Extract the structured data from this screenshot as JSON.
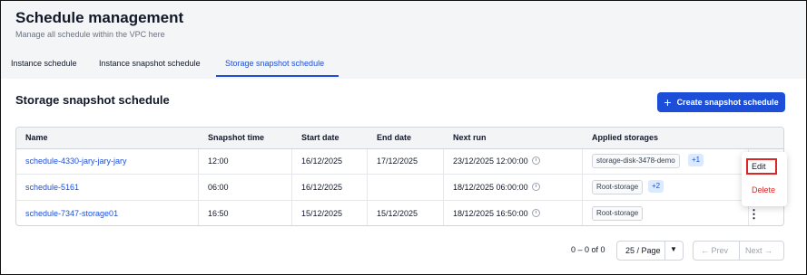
{
  "header": {
    "title": "Schedule management",
    "subtitle": "Manage all schedule within the VPC here"
  },
  "tabs": [
    {
      "label": "Instance schedule",
      "active": false
    },
    {
      "label": "Instance snapshot schedule",
      "active": false
    },
    {
      "label": "Storage snapshot schedule",
      "active": true
    }
  ],
  "section": {
    "title": "Storage snapshot schedule",
    "create_button": "Create snapshot schedule",
    "create_icon": "plus-icon"
  },
  "table": {
    "columns": [
      "Name",
      "Snapshot time",
      "Start date",
      "End date",
      "Next run",
      "Applied storages"
    ],
    "rows": [
      {
        "name": "schedule-4330-jary-jary-jary",
        "time": "12:00",
        "start": "16/12/2025",
        "end": "17/12/2025",
        "next": "23/12/2025 12:00:00",
        "storage": "storage-disk-3478-demo",
        "more": "+1"
      },
      {
        "name": "schedule-5161",
        "time": "06:00",
        "start": "16/12/2025",
        "end": "",
        "next": "18/12/2025 06:00:00",
        "storage": "Root-storage",
        "more": "+2"
      },
      {
        "name": "schedule-7347-storage01",
        "time": "16:50",
        "start": "15/12/2025",
        "end": "15/12/2025",
        "next": "18/12/2025 16:50:00",
        "storage": "Root-storage",
        "more": ""
      }
    ]
  },
  "context_menu": {
    "edit": "Edit",
    "delete": "Delete"
  },
  "pagination": {
    "count": "0 – 0 of 0",
    "per_page": "25 / Page",
    "prev": "← Prev",
    "next": "Next →"
  },
  "colors": {
    "accent": "#1d4ed8",
    "danger": "#dc2626",
    "header_bg": "#f4f5f7"
  }
}
